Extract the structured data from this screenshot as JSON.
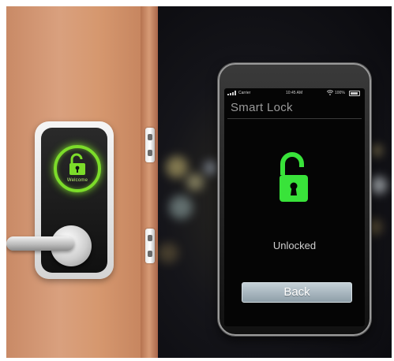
{
  "door_lock": {
    "screen_text": "Welcome",
    "ring_color": "#7cdc2a",
    "icon": "unlocked-padlock-icon"
  },
  "phone": {
    "status_bar": {
      "carrier": "Carrier",
      "time": "10:45 AM",
      "battery": "100%",
      "icons": [
        "signal-icon",
        "wifi-icon",
        "battery-icon"
      ]
    },
    "app_title": "Smart Lock",
    "lock_icon": "unlocked-padlock-icon",
    "lock_color": "#39e33a",
    "status_text": "Unlocked",
    "back_button_label": "Back"
  }
}
